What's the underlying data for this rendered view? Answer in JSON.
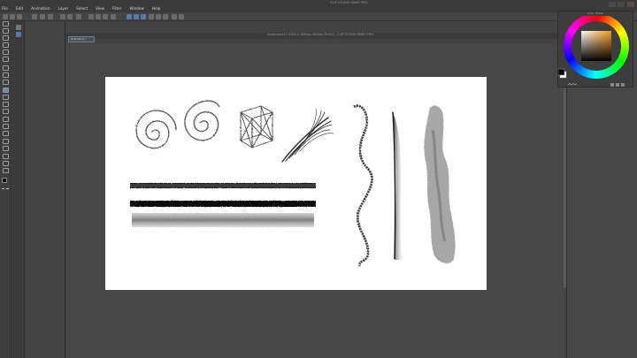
{
  "app": {
    "title": "CLIP STUDIO PAINT PRO",
    "document_title": "Illustration1* (1920 x 1080px 350dpi 76.6%) - CLIP STUDIO PAINT PRO",
    "document_tab": "Illustration1*"
  },
  "menu": {
    "items": [
      "File",
      "Edit",
      "Animation",
      "Layer",
      "Select",
      "View",
      "Filter",
      "Window",
      "Help"
    ]
  },
  "color_wheel": {
    "title": "Color Wheel",
    "main_color": "#000000",
    "sub_color": "#ffffff",
    "hue_square_color": "#f59a1e"
  },
  "tools": {
    "names": [
      "select-icon",
      "zoom-icon",
      "move-icon",
      "selection-icon",
      "auto-select-icon",
      "eyedropper-icon",
      "pen-icon",
      "pencil-icon",
      "brush-icon",
      "airbrush-icon",
      "decoration-icon",
      "eraser-icon",
      "blend-icon",
      "fill-icon",
      "gradient-icon",
      "figure-icon",
      "frame-icon",
      "ruler-icon",
      "text-icon",
      "balloon-icon",
      "correct-line-icon"
    ]
  },
  "colors": {
    "accent": "#5a78b0",
    "panel_bg": "#474747",
    "canvas_bg": "#ffffff"
  }
}
